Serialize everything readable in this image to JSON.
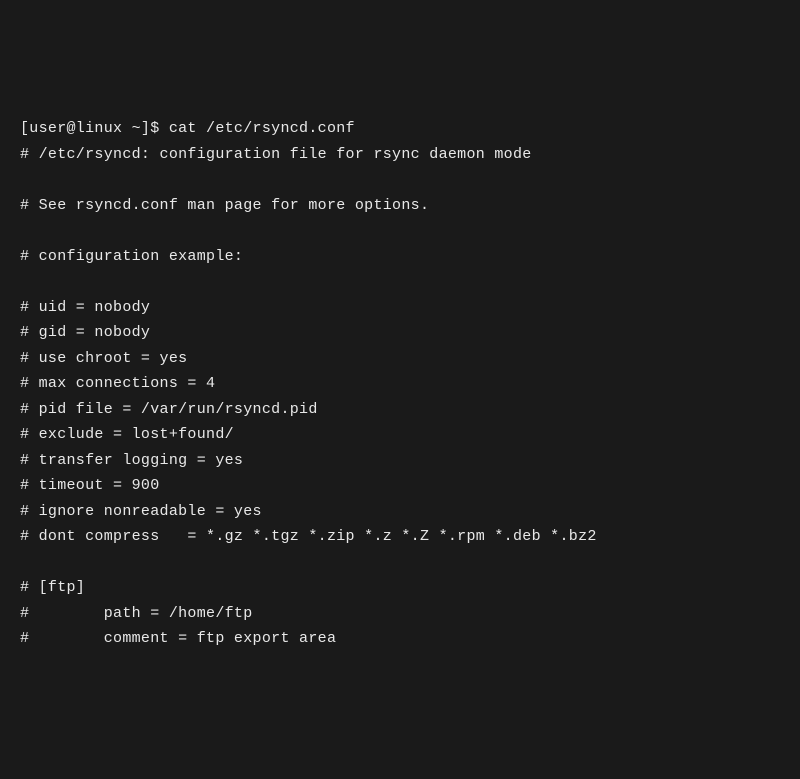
{
  "terminal": {
    "lines": [
      "[user@linux ~]$ cat /etc/rsyncd.conf",
      "# /etc/rsyncd: configuration file for rsync daemon mode",
      "",
      "# See rsyncd.conf man page for more options.",
      "",
      "# configuration example:",
      "",
      "# uid = nobody",
      "# gid = nobody",
      "# use chroot = yes",
      "# max connections = 4",
      "# pid file = /var/run/rsyncd.pid",
      "# exclude = lost+found/",
      "# transfer logging = yes",
      "# timeout = 900",
      "# ignore nonreadable = yes",
      "# dont compress   = *.gz *.tgz *.zip *.z *.Z *.rpm *.deb *.bz2",
      "",
      "# [ftp]",
      "#        path = /home/ftp",
      "#        comment = ftp export area"
    ]
  }
}
